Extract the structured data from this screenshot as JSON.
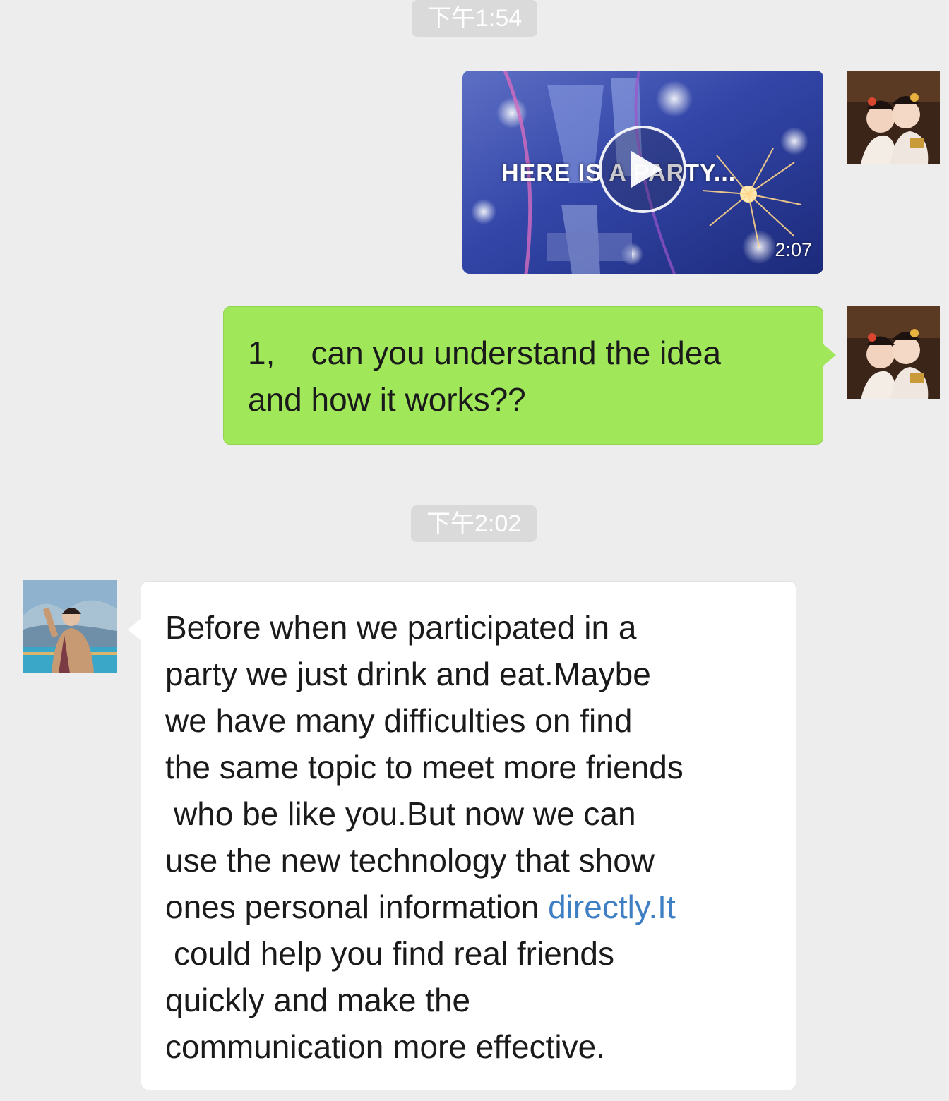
{
  "timestamps": {
    "first": "下午1:54",
    "second": "下午2:02"
  },
  "video_message": {
    "caption": "HERE IS A PARTY...",
    "duration": "2:07"
  },
  "outgoing_message": {
    "lines": [
      "1,    can you understand the idea",
      "and how it works??"
    ]
  },
  "incoming_message": {
    "lines": [
      "Before when we participated in a",
      "party we just drink and eat.Maybe",
      "we have many difficulties on find",
      "the same topic to meet more friends",
      "who be like you.But now we can",
      "use the new technology that show",
      "ones personal information ",
      "could help you find real friends",
      "quickly and make the",
      "communication more effective."
    ],
    "link_text": "directly.It"
  },
  "colors": {
    "background": "#ededed",
    "outgoing_bubble": "#a0e75a",
    "incoming_bubble": "#ffffff",
    "link": "#3f7fc4",
    "timestamp_bg": "#dadada"
  }
}
